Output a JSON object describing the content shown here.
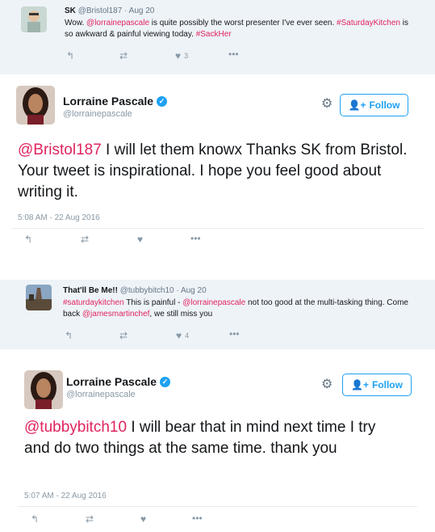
{
  "tweets": [
    {
      "type": "reply",
      "name": "SK",
      "handle": "@Bristol187",
      "date": "Aug 20",
      "text_parts": [
        {
          "t": "Wow. ",
          "c": ""
        },
        {
          "t": "@lorrainepascale",
          "c": "mention"
        },
        {
          "t": " is quite possibly the worst presenter I've ever seen.",
          "c": ""
        },
        {
          "t": " #SaturdayKitchen",
          "c": "hashtag"
        },
        {
          "t": " is so awkward & painful viewing today. ",
          "c": ""
        },
        {
          "t": "#SackHer",
          "c": "hashtag"
        }
      ],
      "likes": "3"
    },
    {
      "type": "main",
      "name": "Lorraine Pascale",
      "handle": "@lorrainepascale",
      "follow_label": "Follow",
      "text_parts": [
        {
          "t": "@Bristol187",
          "c": "mention"
        },
        {
          "t": " I will let them knowx Thanks SK from Bristol. Your tweet is inspirational. I hope you feel good about writing it.",
          "c": ""
        }
      ],
      "timestamp": "5:08 AM - 22 Aug 2016"
    },
    {
      "type": "reply",
      "name": "That'll Be Me!!",
      "handle": "@tubbybitch10",
      "date": "Aug 20",
      "text_parts": [
        {
          "t": "#saturdaykitchen",
          "c": "hashtag"
        },
        {
          "t": " This is painful - ",
          "c": ""
        },
        {
          "t": "@lorrainepascale",
          "c": "mention"
        },
        {
          "t": " not too good at the multi-tasking thing. Come back ",
          "c": ""
        },
        {
          "t": "@jamesmartinchef",
          "c": "mention"
        },
        {
          "t": ", we still miss you",
          "c": ""
        }
      ],
      "likes": "4"
    },
    {
      "type": "main",
      "name": "Lorraine Pascale",
      "handle": "@lorrainepascale",
      "follow_label": "Follow",
      "text_parts": [
        {
          "t": "@tubbybitch10",
          "c": "mention"
        },
        {
          "t": "  I will bear that in mind next time I try and do two things at the same time. thank you",
          "c": ""
        }
      ],
      "timestamp": "5:07 AM - 22 Aug 2016"
    }
  ],
  "icons": {
    "reply": "reply-icon",
    "retweet": "retweet-icon",
    "like": "heart-icon",
    "more": "more-icon",
    "gear": "gear-icon",
    "follow": "follow-person-icon",
    "verified": "verified-badge-icon"
  },
  "colors": {
    "link": "#e0245e",
    "reply_bg": "#eef3f8",
    "follow_blue": "#1da1f2",
    "muted": "#8899a6"
  },
  "separators": {
    "dot": "·",
    "verified_check": "✓"
  }
}
